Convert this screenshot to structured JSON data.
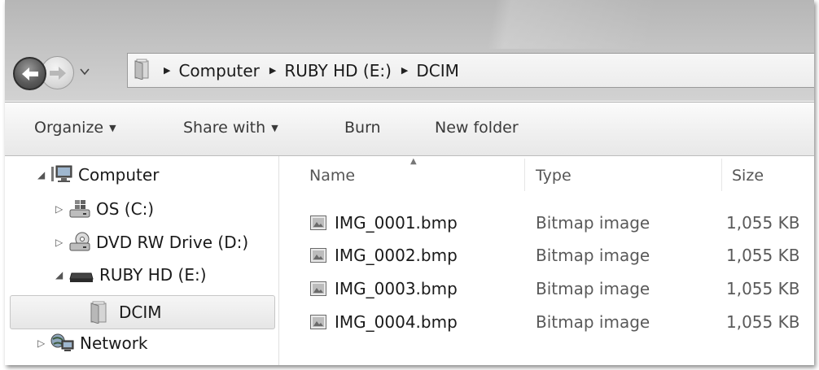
{
  "address": {
    "crumbs": [
      "Computer",
      "RUBY HD (E:)",
      "DCIM"
    ]
  },
  "toolbar": {
    "organize": "Organize",
    "share_with": "Share with",
    "burn": "Burn",
    "new_folder": "New folder"
  },
  "tree": {
    "computer": "Computer",
    "os": "OS (C:)",
    "dvd": "DVD RW Drive (D:)",
    "ruby": "RUBY HD (E:)",
    "dcim": "DCIM",
    "network": "Network"
  },
  "columns": {
    "name": "Name",
    "type": "Type",
    "size": "Size"
  },
  "files": [
    {
      "name": "IMG_0001.bmp",
      "type": "Bitmap image",
      "size": "1,055 KB"
    },
    {
      "name": "IMG_0002.bmp",
      "type": "Bitmap image",
      "size": "1,055 KB"
    },
    {
      "name": "IMG_0003.bmp",
      "type": "Bitmap image",
      "size": "1,055 KB"
    },
    {
      "name": "IMG_0004.bmp",
      "type": "Bitmap image",
      "size": "1,055 KB"
    }
  ]
}
